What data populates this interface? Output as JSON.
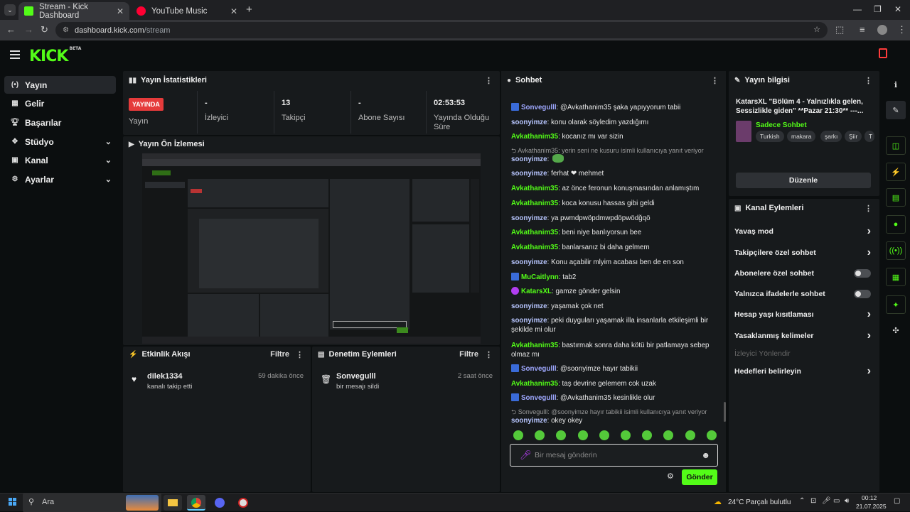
{
  "browser": {
    "tabs": [
      {
        "title": "Stream - Kick Dashboard",
        "active": true
      },
      {
        "title": "YouTube Music",
        "active": false
      }
    ],
    "url_host": "dashboard.kick.com",
    "url_path": "/stream"
  },
  "kick": {
    "logo": "KICK",
    "logo_badge": "BETA"
  },
  "sidebar": {
    "items": [
      {
        "label": "Yayın",
        "icon": "broadcast-icon",
        "active": true,
        "expandable": false
      },
      {
        "label": "Gelir",
        "icon": "revenue-icon",
        "active": false,
        "expandable": false
      },
      {
        "label": "Başarılar",
        "icon": "trophy-icon",
        "active": false,
        "expandable": false
      },
      {
        "label": "Stüdyo",
        "icon": "studio-icon",
        "active": false,
        "expandable": true
      },
      {
        "label": "Kanal",
        "icon": "channel-icon",
        "active": false,
        "expandable": true
      },
      {
        "label": "Ayarlar",
        "icon": "gear-icon",
        "active": false,
        "expandable": true
      }
    ]
  },
  "stats": {
    "title": "Yayın İstatistikleri",
    "live_badge": "YAYINDA",
    "live_label": "Yayın",
    "viewers_value": "-",
    "viewers_label": "İzleyici",
    "followers_value": "13",
    "followers_label": "Takipçi",
    "subs_value": "-",
    "subs_label": "Abone Sayısı",
    "duration_value": "02:53:53",
    "duration_label": "Yayında Olduğu Süre"
  },
  "preview": {
    "title": "Yayın Ön İzlemesi"
  },
  "activity": {
    "title": "Etkinlik Akışı",
    "filter": "Filtre",
    "item": {
      "name": "dilek1334",
      "text": "kanalı takip etti",
      "time": "59 dakika önce"
    }
  },
  "moderation": {
    "title": "Denetim Eylemleri",
    "filter": "Filtre",
    "item": {
      "name": "Sonvegulll",
      "text": "bir mesajı sildi",
      "time": "2 saat önce"
    }
  },
  "chat": {
    "title": "Sohbet",
    "messages": [
      {
        "user": "Sonvegulll",
        "color": "#9fa8ff",
        "badge": true,
        "text": "@Avkathanim35 şaka yapıyyorum tabii"
      },
      {
        "user": "soonyimze",
        "color": "#b8c6ff",
        "text": "konu olarak söyledim yazdığımı"
      },
      {
        "user": "Avkathanim35",
        "color": "#53fc18",
        "text": "kocanız mı var sizin"
      },
      {
        "reply": "Avkathanim35: yerin seni ne kusuru isimli kullanıcıya yanıt veriyor"
      },
      {
        "user": "soonyimze",
        "color": "#b8c6ff",
        "text": ""
      },
      {
        "user": "soonyimze",
        "color": "#b8c6ff",
        "text": "ferhat ❤ mehmet"
      },
      {
        "user": "Avkathanim35",
        "color": "#53fc18",
        "text": "az önce feronun konuşmasından anlamıştım"
      },
      {
        "user": "Avkathanim35",
        "color": "#53fc18",
        "text": "koca konusu hassas gibi geldi"
      },
      {
        "user": "soonyimze",
        "color": "#b8c6ff",
        "text": "ya pwmdpwöpdmwpdöpwödğqö"
      },
      {
        "user": "Avkathanim35",
        "color": "#53fc18",
        "text": "beni niye banlıyorsun bee"
      },
      {
        "user": "Avkathanim35",
        "color": "#53fc18",
        "text": "banlarsanız bi daha gelmem"
      },
      {
        "user": "soonyimze",
        "color": "#b8c6ff",
        "text": "Konu açabilir mlyim acabası ben de en son"
      },
      {
        "user": "MuCaitlynn",
        "color": "#53fc18",
        "badge": true,
        "text": "tab2"
      },
      {
        "user": "KatarsXL",
        "color": "#53fc18",
        "mic": true,
        "text": "gamze gönder gelsin"
      },
      {
        "user": "soonyimze",
        "color": "#b8c6ff",
        "text": "yaşamak çok net"
      },
      {
        "user": "soonyimze",
        "color": "#b8c6ff",
        "text": "peki duyguları yaşamak illa insanlarla etkileşimli bir şekilde mi olur"
      },
      {
        "user": "Avkathanim35",
        "color": "#53fc18",
        "text": "bastırmak sonra daha kötü bir patlamaya sebep olmaz mı"
      },
      {
        "user": "Sonvegulll",
        "color": "#9fa8ff",
        "badge": true,
        "text": "@soonyimze hayır tabikii"
      },
      {
        "user": "Avkathanim35",
        "color": "#53fc18",
        "text": "taş devrine gelemem cok uzak"
      },
      {
        "user": "Sonvegulll",
        "color": "#9fa8ff",
        "badge": true,
        "text": "@Avkathanim35 kesinlikle olur"
      },
      {
        "reply": "Sonvegulll: @soonyimze hayır tabikii isimli kullanıcıya yanıt veriyor"
      },
      {
        "user": "soonyimze",
        "color": "#b8c6ff",
        "text": "okey okey"
      }
    ],
    "input_placeholder": "Bir mesaj gönderin",
    "send_label": "Gönder"
  },
  "stream_info": {
    "title": "Yayın bilgisi",
    "stream_title": "KatarsXL \"Bölüm 4 - Yalnızlıkla gelen, Sessizlikle giden\" **Pazar 21:30** ---...",
    "category": "Sadece Sohbet",
    "tags": [
      "Turkish",
      "makara",
      "şarkı",
      "Şiir",
      "T"
    ],
    "edit_label": "Düzenle"
  },
  "channel_actions": {
    "title": "Kanal Eylemleri",
    "items": [
      {
        "label": "Yavaş mod",
        "type": "arrow"
      },
      {
        "label": "Takipçilere özel sohbet",
        "type": "arrow"
      },
      {
        "label": "Abonelere özel sohbet",
        "type": "toggle"
      },
      {
        "label": "Yalnızca ifadelerle sohbet",
        "type": "toggle"
      },
      {
        "label": "Hesap yaşı kısıtlaması",
        "type": "arrow"
      },
      {
        "label": "Yasaklanmış kelimeler",
        "type": "arrow"
      },
      {
        "label": "İzleyici Yönlendir",
        "type": "disabled"
      },
      {
        "label": "Hedefleri belirleyin",
        "type": "arrow"
      }
    ]
  },
  "taskbar": {
    "search_placeholder": "Ara",
    "weather": "24°C  Parçalı bulutlu",
    "time": "00:12",
    "date": "21.07.2025"
  }
}
